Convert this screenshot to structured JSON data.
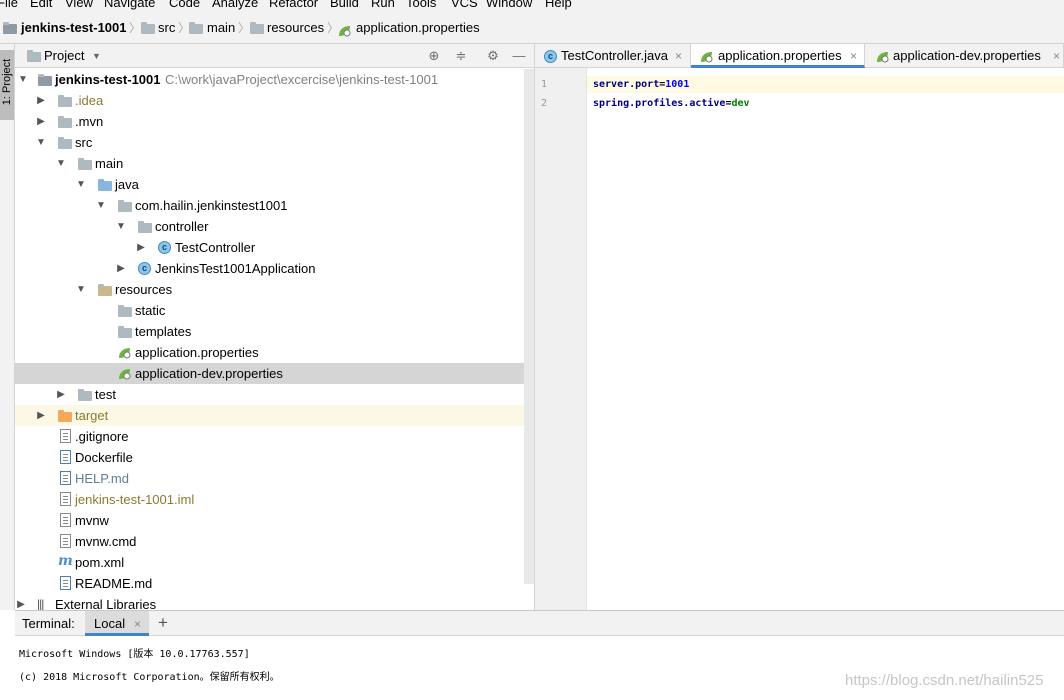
{
  "menubar": {
    "items": [
      "File",
      "Edit",
      "View",
      "Navigate",
      "Code",
      "Analyze",
      "Refactor",
      "Build",
      "Run",
      "Tools",
      "VCS",
      "Window",
      "Help"
    ]
  },
  "navbar": {
    "breadcrumbs": [
      "jenkins-test-1001",
      "src",
      "main",
      "resources",
      "application.properties"
    ]
  },
  "side_strip": {
    "label": "1: Project"
  },
  "project_panel": {
    "title": "Project",
    "root_name": "jenkins-test-1001",
    "root_path": "C:\\work\\javaProject\\excercise\\jenkins-test-1001",
    "tree": [
      {
        "label": ".idea"
      },
      {
        "label": ".mvn"
      },
      {
        "label": "src"
      },
      {
        "label": "main"
      },
      {
        "label": "java"
      },
      {
        "label": "com.hailin.jenkinstest1001"
      },
      {
        "label": "controller"
      },
      {
        "label": "TestController"
      },
      {
        "label": "JenkinsTest1001Application"
      },
      {
        "label": "resources"
      },
      {
        "label": "static"
      },
      {
        "label": "templates"
      },
      {
        "label": "application.properties"
      },
      {
        "label": "application-dev.properties"
      },
      {
        "label": "test"
      },
      {
        "label": "target"
      },
      {
        "label": ".gitignore"
      },
      {
        "label": "Dockerfile"
      },
      {
        "label": "HELP.md"
      },
      {
        "label": "jenkins-test-1001.iml"
      },
      {
        "label": "mvnw"
      },
      {
        "label": "mvnw.cmd"
      },
      {
        "label": "pom.xml"
      },
      {
        "label": "README.md"
      },
      {
        "label": "External Libraries"
      }
    ]
  },
  "editor": {
    "tabs": [
      {
        "label": "TestController.java"
      },
      {
        "label": "application.properties"
      },
      {
        "label": "application-dev.properties"
      }
    ],
    "lines": [
      {
        "number": "1",
        "key": "server.port",
        "eq": "=",
        "value": "1001"
      },
      {
        "number": "2",
        "key": "spring.profiles.active",
        "eq": "=",
        "value": "dev"
      }
    ]
  },
  "terminal": {
    "title": "Terminal:",
    "tab": "Local",
    "add": "+",
    "lines": [
      "Microsoft Windows [版本 10.0.17763.557]",
      "(c) 2018 Microsoft Corporation。保留所有权利。"
    ]
  },
  "watermark": "https://blog.csdn.net/hailin525",
  "colors": {
    "accent": "#4083c9",
    "selection": "#d5d5d5",
    "excluded": "#fbf9e6"
  }
}
